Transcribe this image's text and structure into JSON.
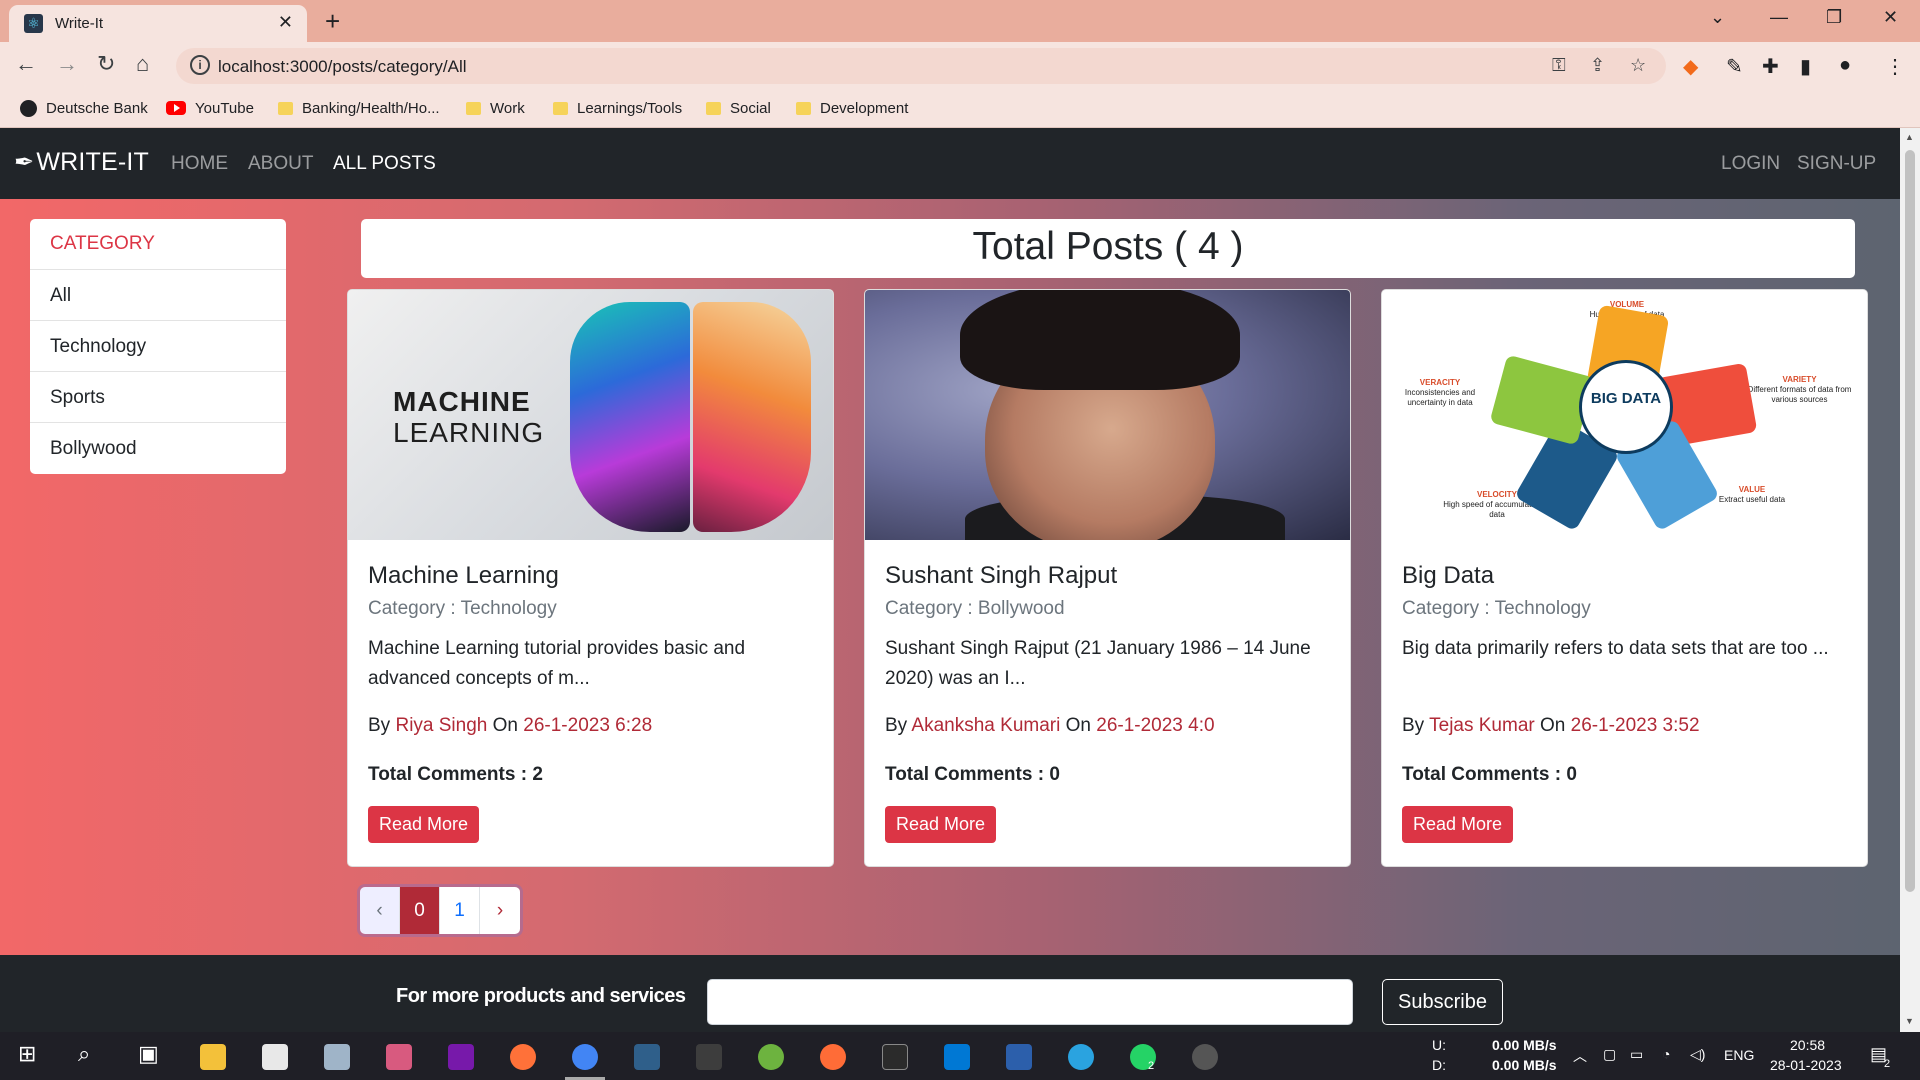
{
  "browser": {
    "tab_title": "Write-It",
    "url": "localhost:3000/posts/category/All",
    "bookmarks": [
      "Deutsche Bank",
      "YouTube",
      "Banking/Health/Ho...",
      "Work",
      "Learnings/Tools",
      "Social",
      "Development"
    ]
  },
  "nav": {
    "brand": "WRITE-IT",
    "links": [
      "HOME",
      "ABOUT",
      "ALL POSTS"
    ],
    "right_links": [
      "LOGIN",
      "SIGN-UP"
    ]
  },
  "sidebar": {
    "header": "CATEGORY",
    "items": [
      "All",
      "Technology",
      "Sports",
      "Bollywood"
    ]
  },
  "total_posts": "Total Posts ( 4 )",
  "posts": [
    {
      "title": "Machine Learning",
      "category": "Category : Technology",
      "description": "Machine Learning tutorial provides basic and advanced concepts of m...",
      "by_label": "By",
      "author": "Riya Singh",
      "on_label": "On",
      "date": "26-1-2023 6:28",
      "comments": "Total Comments : 2",
      "button": "Read More",
      "image_text_1": "MACHINE",
      "image_text_2": "LEARNING"
    },
    {
      "title": "Sushant Singh Rajput",
      "category": "Category : Bollywood",
      "description": "Sushant Singh Rajput (21 January 1986 – 14 June 2020) was an I...",
      "by_label": "By",
      "author": "Akanksha Kumari",
      "on_label": "On",
      "date": "26-1-2023 4:0",
      "comments": "Total Comments : 0",
      "button": "Read More"
    },
    {
      "title": "Big Data",
      "category": "Category : Technology",
      "description": "Big data primarily refers to data sets that are too ...",
      "by_label": "By",
      "author": "Tejas Kumar",
      "on_label": "On",
      "date": "26-1-2023 3:52",
      "comments": "Total Comments : 0",
      "button": "Read More",
      "image_center": "BIG DATA",
      "image_labels": {
        "volume": "VOLUME",
        "volume_desc": "Huge amount of data",
        "variety": "VARIETY",
        "variety_desc": "Different formats of data from various sources",
        "value": "VALUE",
        "value_desc": "Extract useful data",
        "velocity": "VELOCITY",
        "velocity_desc": "High speed of accumulation of data",
        "veracity": "VERACITY",
        "veracity_desc": "Inconsistencies and uncertainty in data"
      }
    }
  ],
  "pagination": {
    "prev": "‹",
    "pages": [
      "0",
      "1"
    ],
    "next": "›",
    "current": "0"
  },
  "footer": {
    "text": "For more products and services",
    "button": "Subscribe"
  },
  "taskbar": {
    "disk_u_label": "U:",
    "disk_u": "0.00 MB/s",
    "disk_d_label": "D:",
    "disk_d": "0.00 MB/s",
    "lang": "ENG",
    "time": "20:58",
    "date": "28-01-2023",
    "notif_count": "2",
    "whatsapp_badge": "2"
  },
  "colors": {
    "accent": "#dc3545",
    "dark": "#212529",
    "link_red": "#b02a37"
  }
}
